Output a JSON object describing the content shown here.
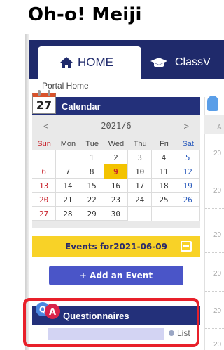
{
  "app": {
    "title": "Oh-o! Meiji"
  },
  "nav": {
    "tabs": [
      {
        "label": "HOME",
        "icon": "home-icon",
        "active": true
      },
      {
        "label": "ClassV",
        "icon": "graduation-cap-icon",
        "active": false
      }
    ]
  },
  "breadcrumb": "Portal Home",
  "calendar": {
    "title": "Calendar",
    "icon_day": "27",
    "month_label": "2021/6",
    "prev": "<",
    "next": ">",
    "weekdays": [
      "Sun",
      "Mon",
      "Tue",
      "Wed",
      "Thu",
      "Fri",
      "Sat"
    ],
    "weeks": [
      [
        "",
        "",
        "1",
        "2",
        "3",
        "4",
        "5"
      ],
      [
        "6",
        "7",
        "8",
        "9",
        "10",
        "11",
        "12"
      ],
      [
        "13",
        "14",
        "15",
        "16",
        "17",
        "18",
        "19"
      ],
      [
        "20",
        "21",
        "22",
        "23",
        "24",
        "25",
        "26"
      ],
      [
        "27",
        "28",
        "29",
        "30",
        "",
        "",
        ""
      ]
    ],
    "today": "9",
    "events_label": "Events for2021-06-09",
    "add_event_label": "+ Add an Event"
  },
  "questionnaires": {
    "title": "Questionnaires",
    "list_label": "List"
  },
  "right_column": {
    "entries": [
      "A",
      "20",
      "20",
      "20",
      "20",
      "20",
      "20"
    ]
  },
  "colors": {
    "nav_bg": "#1f2a6b",
    "panel_header": "#23307a",
    "events_bar": "#f8d227",
    "button": "#4a55c8",
    "highlight": "#e8202a",
    "today": "#f3c300"
  }
}
